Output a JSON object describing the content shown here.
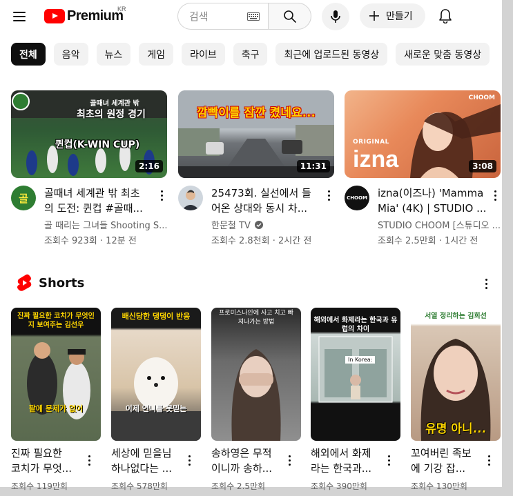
{
  "header": {
    "logo_text": "Premium",
    "logo_region": "KR",
    "search_placeholder": "검색",
    "create_label": "만들기"
  },
  "chips": [
    "전체",
    "음악",
    "뉴스",
    "게임",
    "라이브",
    "축구",
    "최근에 업로드된 동영상",
    "새로운 맞춤 동영상"
  ],
  "videos": [
    {
      "title_line1": "골때녀 세계관 밖 최초",
      "title_line2": "의 도전: 퀸컵 #골때...",
      "channel": "골 때리는 그녀들 Shooting S...",
      "meta": "조회수 923회 · 12분 전",
      "duration": "2:16",
      "thumb_text_1": "골때녀 세계관 밖",
      "thumb_text_2": "최초의 원정 경기",
      "thumb_text_3": "퀸컵(K-WIN CUP)",
      "avatar_text": "골"
    },
    {
      "title_line1": "25473회. 실선에서 들",
      "title_line2": "어온 상대와 동시 차...",
      "channel": "한문철 TV",
      "meta": "조회수 2.8천회 · 2시간 전",
      "duration": "11:31",
      "thumb_text_1": "깜빡이를 잠깐 켰네요..."
    },
    {
      "title_line1": "izna(이즈나) 'Mamma",
      "title_line2": "Mia' (4K) | STUDIO ...",
      "channel": "STUDIO CHOOM [스튜디오 ...",
      "meta": "조회수 2.5만회 · 1시간 전",
      "duration": "3:08",
      "thumb_text_1": "izna",
      "thumb_text_2": "ORIGINAL",
      "thumb_text_3": "CHOOM",
      "avatar_text": "CHOOM"
    }
  ],
  "shorts_section": {
    "title": "Shorts"
  },
  "shorts": [
    {
      "title_line1": "진짜 필요한",
      "title_line2": "코치가 무엇...",
      "views": "조회수 119만회",
      "caption_top": "진짜 필요한 코치가 무엇인지 보여주는 김선우",
      "caption_bottom": "팔에 문제가 없어"
    },
    {
      "title_line1": "세상에 믿을님",
      "title_line2": "하나없다는 ...",
      "views": "조회수 578만회",
      "caption_top": "배신당한 댕댕이 반응",
      "caption_bottom": "이제 언니를 못믿는"
    },
    {
      "title_line1": "송하영은 무적",
      "title_line2": "이니까 송하...",
      "views": "조회수 2.5만회",
      "caption_top": "프로미스나인에 사고 치고 빠져나가는 방법",
      "caption_bottom": ""
    },
    {
      "title_line1": "해외에서 화제",
      "title_line2": "라는 한국과...",
      "views": "조회수 390만회",
      "caption_top": "해외에서 화제라는 한국과 유럽의 차이",
      "caption_bottom": "In Korea:"
    },
    {
      "title_line1": "꼬여버린 족보",
      "title_line2": "에 기강 잡...",
      "views": "조회수 130만회",
      "caption_top": "서열 정리하는 김희선",
      "caption_bottom": "유명 아니..."
    }
  ]
}
